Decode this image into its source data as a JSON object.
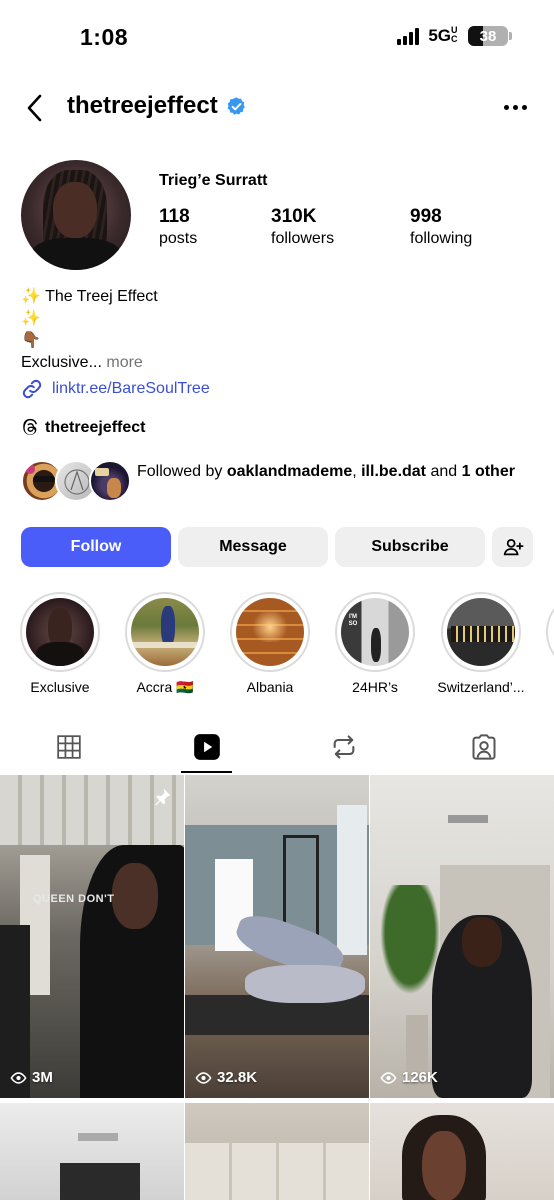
{
  "status_bar": {
    "time": "1:08",
    "network": "5G",
    "network_suffix": "UC",
    "battery": "38"
  },
  "header": {
    "username": "thetreejeffect"
  },
  "profile": {
    "full_name": "Trieg’e Surratt",
    "stats": [
      {
        "value": "118",
        "label": "posts"
      },
      {
        "value": "310K",
        "label": "followers"
      },
      {
        "value": "998",
        "label": "following"
      }
    ],
    "bio_line1": "✨ The Treej Effect",
    "bio_line2": "✨",
    "bio_line3": "👇🏾",
    "bio_line4": "Exclusive...",
    "bio_more": "more",
    "link": "linktr.ee/BareSoulTree",
    "threads_handle": "thetreejeffect",
    "followed_by_prefix": "Followed by ",
    "followed_by_user1": "oaklandmademe",
    "followed_by_sep": ", ",
    "followed_by_user2": "ill.be.dat",
    "followed_by_and": " and ",
    "followed_by_other": "1 other"
  },
  "actions": {
    "follow": "Follow",
    "message": "Message",
    "subscribe": "Subscribe"
  },
  "highlights": [
    {
      "label": "Exclusive"
    },
    {
      "label": "Accra 🇬🇭"
    },
    {
      "label": "Albania"
    },
    {
      "label": "24HR’s"
    },
    {
      "label": "Switzerland’..."
    }
  ],
  "grid": [
    {
      "views": "3M",
      "overlay": "QUEEN DON'T"
    },
    {
      "views": "32.8K"
    },
    {
      "views": "126K"
    }
  ],
  "colors": {
    "accent": "#4a5df9",
    "link": "#3b4fd6",
    "verified": "#3897f0"
  }
}
